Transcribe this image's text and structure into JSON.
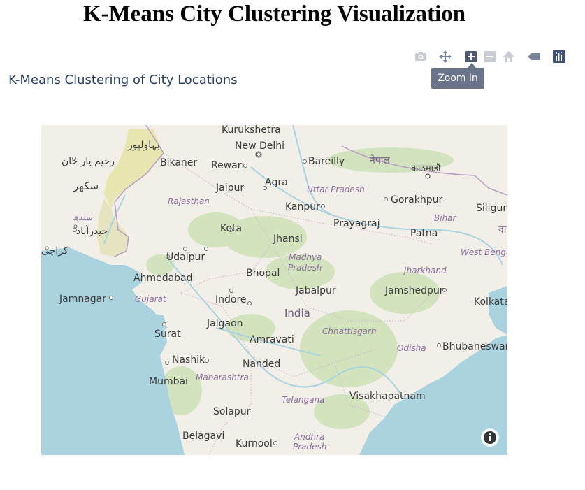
{
  "page": {
    "title": "K-Means City Clustering Visualization"
  },
  "plot": {
    "title": "K-Means Clustering of City Locations"
  },
  "modebar": {
    "buttons": [
      {
        "icon": "camera-icon",
        "label": "Download plot as a png"
      },
      {
        "icon": "pan-icon",
        "label": "Pan"
      },
      {
        "icon": "zoom-in-icon",
        "label": "Zoom in"
      },
      {
        "icon": "zoom-out-icon",
        "label": "Zoom out"
      },
      {
        "icon": "home-icon",
        "label": "Reset view"
      },
      {
        "icon": "tag-icon",
        "label": "Toggle spike lines"
      },
      {
        "icon": "plotly-logo-icon",
        "label": "Produced with Plotly"
      }
    ],
    "tooltip": "Zoom in"
  },
  "map": {
    "colors": {
      "water": "#aad3df",
      "land": "#f2efe9",
      "forest": "#c8dfb0",
      "desert": "#e8e6b0"
    },
    "cities": [
      "Kurukshetra",
      "New Delhi",
      "Bareilly",
      "Bikaner",
      "Rewari",
      "Agra",
      "Jaipur",
      "Kanpur",
      "Gorakhpur",
      "Siligur",
      "Kota",
      "Prayagraj",
      "Jhansi",
      "Patna",
      "Udaipur",
      "Ahmedabad",
      "Bhopal",
      "Jamnagar",
      "Jabalpur",
      "Jamshedpur",
      "Indore",
      "Kolkata",
      "Jalgaon",
      "Surat",
      "Amravati",
      "Bhubaneswar",
      "Nashik",
      "Nanded",
      "Mumbai",
      "Visakhapatnam",
      "Solapur",
      "Belagavi",
      "Kurnool"
    ],
    "foreign_labels": [
      "بہاولپور",
      "رحیم یار خان",
      "سکھر",
      "سندھ",
      "حیدرآباد",
      "کراچی",
      "नेपाल",
      "काठमाडौं",
      "বাংলা"
    ],
    "states": [
      "Rajasthan",
      "Uttar Pradesh",
      "Bihar",
      "Madhya Pradesh",
      "Jharkhand",
      "West Benga",
      "Gujarat",
      "Chhattisgarh",
      "Odisha",
      "Maharashtra",
      "Telangana",
      "Andhra Pradesh"
    ],
    "country": "India",
    "info_icon": "info-icon"
  }
}
